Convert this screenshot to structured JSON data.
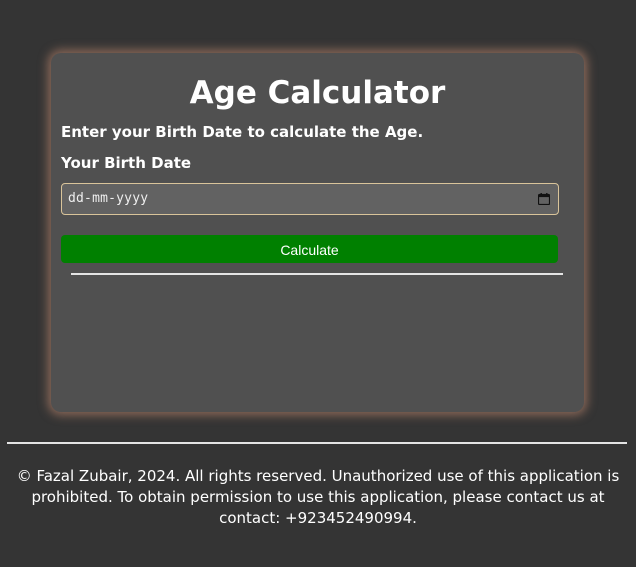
{
  "app": {
    "title": "Age Calculator",
    "subtitle": "Enter your Birth Date to calculate the Age.",
    "birth_date": {
      "label": "Your Birth Date",
      "placeholder": "dd-mm-yyyy",
      "value": ""
    },
    "calculate_label": "Calculate",
    "result": ""
  },
  "footer": {
    "text": "© Fazal Zubair, 2024. All rights reserved. Unauthorized use of this application is prohibited. To obtain permission to use this application, please contact us at contact: +923452490994."
  },
  "colors": {
    "background": "#343434",
    "card": "#505050",
    "card_glow": "#d69678",
    "button": "#008000",
    "input_border": "#d9c49a"
  },
  "icons": {
    "calendar": "calendar-icon"
  }
}
